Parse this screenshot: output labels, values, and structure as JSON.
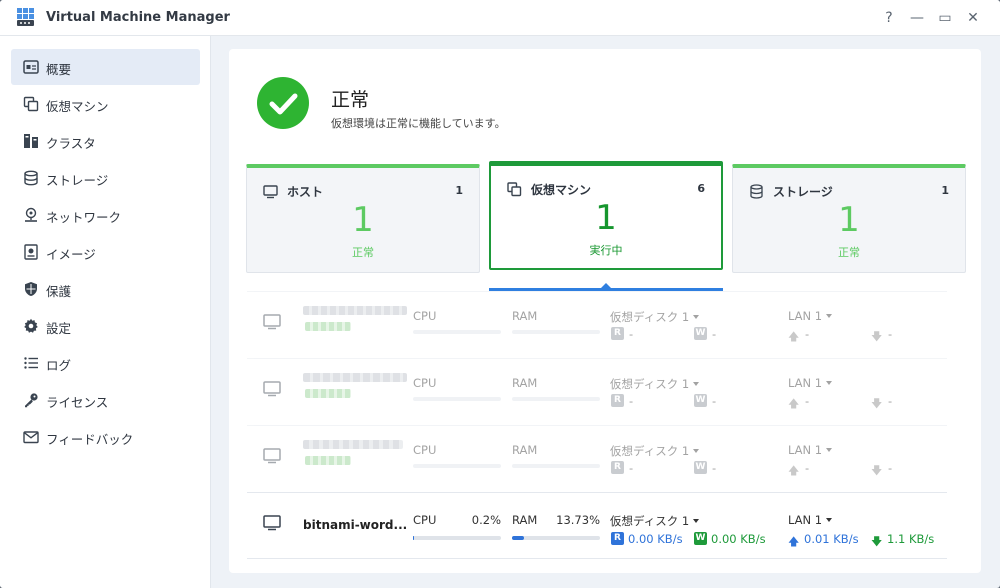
{
  "window": {
    "title": "Virtual Machine Manager",
    "buttons": {
      "help": "?",
      "minimize": "—",
      "maximize": "▭",
      "close": "✕"
    }
  },
  "sidebar": {
    "items": [
      {
        "label": "概要",
        "icon": "overview-icon",
        "active": true
      },
      {
        "label": "仮想マシン",
        "icon": "virtual-machine-icon"
      },
      {
        "label": "クラスタ",
        "icon": "cluster-icon"
      },
      {
        "label": "ストレージ",
        "icon": "storage-icon"
      },
      {
        "label": "ネットワーク",
        "icon": "network-icon"
      },
      {
        "label": "イメージ",
        "icon": "image-icon"
      },
      {
        "label": "保護",
        "icon": "shield-icon"
      },
      {
        "label": "設定",
        "icon": "gear-icon"
      },
      {
        "label": "ログ",
        "icon": "log-icon"
      },
      {
        "label": "ライセンス",
        "icon": "key-icon"
      },
      {
        "label": "フィードバック",
        "icon": "mail-icon"
      }
    ]
  },
  "status": {
    "title": "正常",
    "description": "仮想環境は正常に機能しています。",
    "color": "#2eb432"
  },
  "cards": [
    {
      "title": "ホスト",
      "count": "1",
      "big": "1",
      "sub": "正常",
      "icon": "monitor-icon"
    },
    {
      "title": "仮想マシン",
      "count": "6",
      "big": "1",
      "sub": "実行中",
      "icon": "copy-icon",
      "selected": true
    },
    {
      "title": "ストレージ",
      "count": "1",
      "big": "1",
      "sub": "正常",
      "icon": "database-icon"
    }
  ],
  "vm_list": {
    "labels": {
      "cpu": "CPU",
      "ram": "RAM",
      "disk": "仮想ディスク 1",
      "lan": "LAN 1",
      "read_badge": "R",
      "write_badge": "W",
      "dash": "-",
      "up_arrow": "🡅",
      "down_arrow": "🡇"
    },
    "rows": [
      {
        "name": "",
        "hidden": true
      },
      {
        "name": "",
        "hidden": true
      },
      {
        "name": "",
        "hidden": true
      },
      {
        "name": "bitnami-word...",
        "cpu": "0.2%",
        "cpu_fraction": 0.002,
        "ram": "13.73%",
        "ram_fraction": 0.1373,
        "disk_read": "0.00 KB/s",
        "disk_write": "0.00 KB/s",
        "lan_up": "0.01 KB/s",
        "lan_down": "1.1 KB/s"
      }
    ]
  },
  "colors": {
    "accent_green": "#5dca62",
    "dark_green": "#16962e",
    "blue": "#2f73d9",
    "write_green": "#1e9a3a"
  }
}
